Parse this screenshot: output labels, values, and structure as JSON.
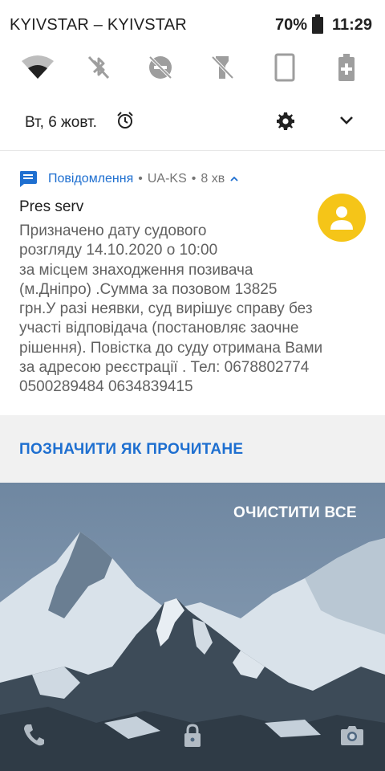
{
  "status_bar": {
    "carrier": "KYIVSTAR – KYIVSTAR",
    "battery_percent": "70%",
    "time": "11:29"
  },
  "quick_settings": {
    "tiles": [
      {
        "icon": "wifi-icon",
        "state": "on"
      },
      {
        "icon": "bluetooth-off-icon",
        "state": "off"
      },
      {
        "icon": "do-not-disturb-off-icon",
        "state": "off"
      },
      {
        "icon": "flashlight-off-icon",
        "state": "off"
      },
      {
        "icon": "auto-rotate-icon",
        "state": "off"
      },
      {
        "icon": "battery-saver-icon",
        "state": "off"
      }
    ],
    "date": "Вт, 6 жовт."
  },
  "notification": {
    "app_name": "Повідомлення",
    "separator": "•",
    "sender_account": "UA-KS",
    "time_ago": "8 хв",
    "title": "Pres serv",
    "body": "Призначено дату судового\nрозгляду 14.10.2020 о 10:00\nза місцем знаходження позивача\n(м.Дніпро) .Сумма за позовом 13825\nгрн.У разі неявки, суд вирішує справу без\nучасті відповідача (постановляє заочне\nрішення). Повістка до суду отримана Вами\nза адресою реєстрації . Тел: 0678802774\n0500289484 0634839415",
    "action": "ПОЗНАЧИТИ ЯК ПРОЧИТАНЕ",
    "avatar_color": "#f5c518",
    "accent_color": "#1e6fd0"
  },
  "clear_all": "ОЧИСТИТИ ВСЕ"
}
